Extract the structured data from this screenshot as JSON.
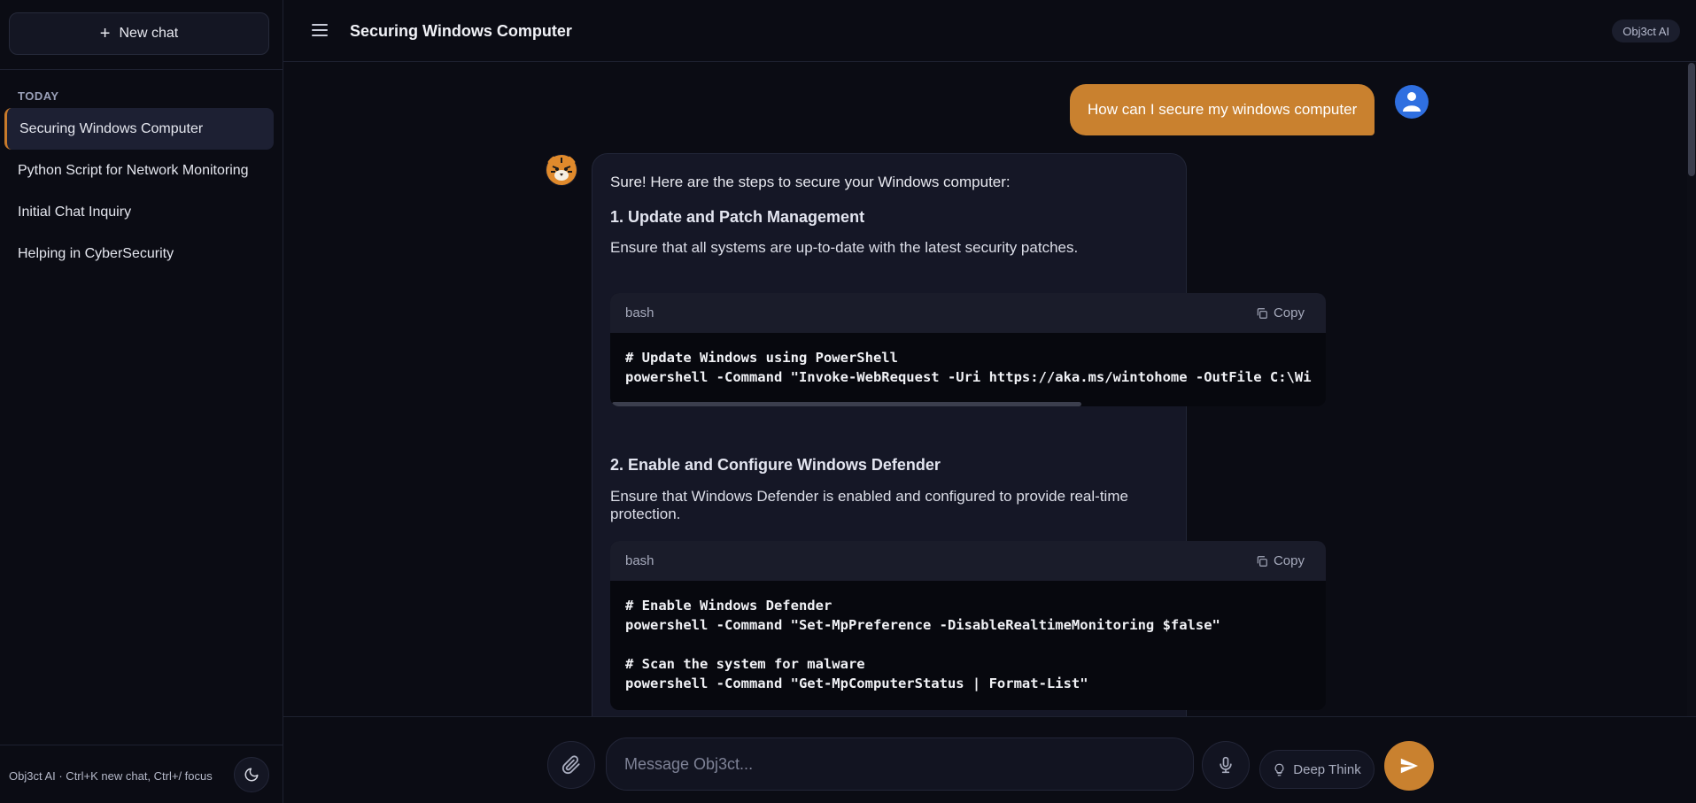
{
  "sidebar": {
    "new_chat_label": "New chat",
    "section_label": "TODAY",
    "items": [
      {
        "label": "Securing Windows Computer",
        "active": true
      },
      {
        "label": "Python Script for Network Monitoring",
        "active": false
      },
      {
        "label": "Initial Chat Inquiry",
        "active": false
      },
      {
        "label": "Helping in CyberSecurity",
        "active": false
      }
    ],
    "footer_text": "Obj3ct AI · Ctrl+K new chat, Ctrl+/ focus",
    "theme_icon": "moon-icon"
  },
  "header": {
    "menu_icon": "hamburger-icon",
    "title": "Securing Windows Computer",
    "brand": "Obj3ct AI"
  },
  "conversation": {
    "user_message": "How can I secure my windows computer",
    "bot": {
      "intro": "Sure! Here are the steps to secure your Windows computer:",
      "sections": [
        {
          "heading": "1. Update and Patch Management",
          "text": "Ensure that all systems are up-to-date with the latest security patches.",
          "code_lang": "bash",
          "copy_label": "Copy",
          "code": "# Update Windows using PowerShell\npowershell -Command \"Invoke-WebRequest -Uri https://aka.ms/wintohome -OutFile C:\\Wi"
        },
        {
          "heading": "2. Enable and Configure Windows Defender",
          "text": "Ensure that Windows Defender is enabled and configured to provide real-time protection.",
          "code_lang": "bash",
          "copy_label": "Copy",
          "code": "# Enable Windows Defender\npowershell -Command \"Set-MpPreference -DisableRealtimeMonitoring $false\"\n\n# Scan the system for malware\npowershell -Command \"Get-MpComputerStatus | Format-List\""
        }
      ]
    }
  },
  "composer": {
    "placeholder": "Message Obj3ct...",
    "deep_think_label": "Deep Think",
    "attach_icon": "paperclip-icon",
    "mic_icon": "microphone-icon",
    "send_icon": "send-icon"
  },
  "colors": {
    "accent": "#c9812f",
    "background": "#0b0c14",
    "card": "#151726",
    "user_avatar": "#2f6fe0"
  }
}
